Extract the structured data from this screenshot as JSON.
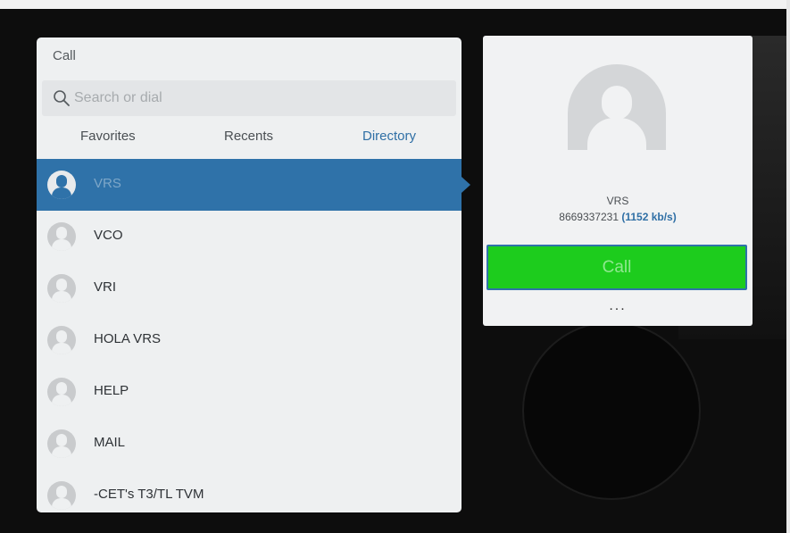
{
  "panel": {
    "title": "Call",
    "search": {
      "placeholder": "Search or dial",
      "value": ""
    },
    "tabs": [
      {
        "label": "Favorites"
      },
      {
        "label": "Recents"
      },
      {
        "label": "Directory",
        "active": true
      }
    ],
    "contacts": [
      {
        "name": "VRS",
        "selected": true
      },
      {
        "name": "VCO"
      },
      {
        "name": "VRI"
      },
      {
        "name": "HOLA VRS"
      },
      {
        "name": "HELP"
      },
      {
        "name": "MAIL"
      },
      {
        "name": "-CET's T3/TL TVM"
      }
    ]
  },
  "detail": {
    "name": "VRS",
    "number": "8669337231",
    "rate": "(1152 kb/s)",
    "call_label": "Call",
    "more_label": "..."
  },
  "colors": {
    "selected": "#2f72a9",
    "accent_text": "#2f6fa5",
    "call_green": "#1dcc1d"
  },
  "icons": [
    "search-icon",
    "avatar-icon"
  ]
}
